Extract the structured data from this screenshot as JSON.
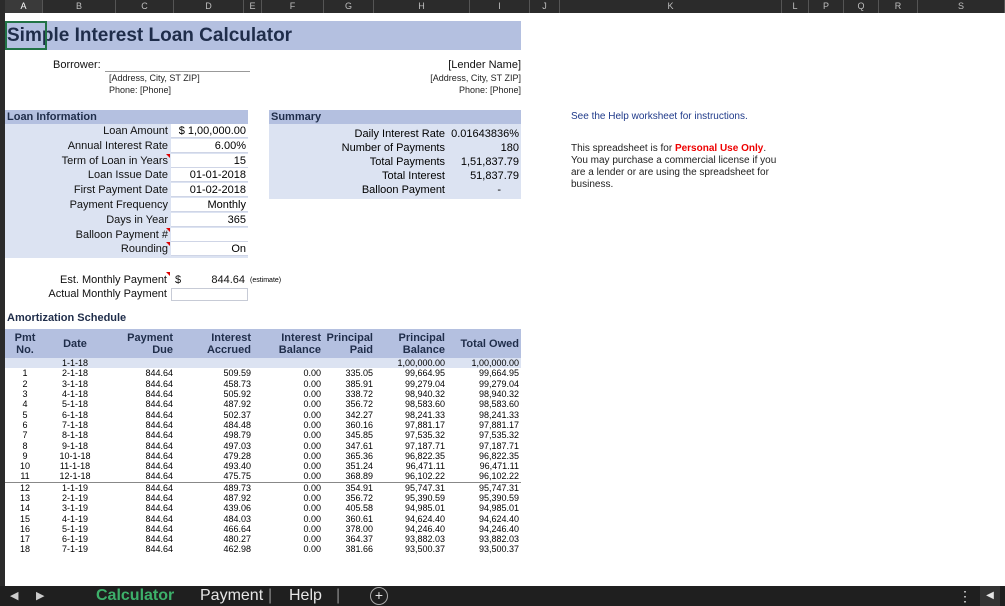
{
  "columns": [
    "A",
    "B",
    "C",
    "D",
    "E",
    "F",
    "G",
    "H",
    "I",
    "J",
    "K",
    "L",
    "P",
    "Q",
    "R",
    "S"
  ],
  "title": "Simple Interest Loan Calculator",
  "borrower": {
    "label": "Borrower:",
    "address": "[Address, City, ST ZIP]",
    "phone": "Phone: [Phone]"
  },
  "lender": {
    "name": "[Lender Name]",
    "address": "[Address, City, ST ZIP]",
    "phone": "Phone: [Phone]"
  },
  "loan_info": {
    "header": "Loan Information",
    "rows": [
      {
        "label": "Loan Amount",
        "value": "$ 1,00,000.00"
      },
      {
        "label": "Annual Interest Rate",
        "value": "6.00%"
      },
      {
        "label": "Term of Loan in Years",
        "value": "15"
      },
      {
        "label": "Loan Issue Date",
        "value": "01-01-2018"
      },
      {
        "label": "First Payment Date",
        "value": "01-02-2018"
      },
      {
        "label": "Payment Frequency",
        "value": "Monthly"
      },
      {
        "label": "Days in Year",
        "value": "365"
      },
      {
        "label": "Balloon Payment #",
        "value": ""
      },
      {
        "label": "Rounding",
        "value": "On"
      }
    ]
  },
  "summary": {
    "header": "Summary",
    "rows": [
      {
        "label": "Daily Interest Rate",
        "value": "0.01643836%"
      },
      {
        "label": "Number of Payments",
        "value": "180"
      },
      {
        "label": "Total Payments",
        "value": "1,51,837.79"
      },
      {
        "label": "Total Interest",
        "value": "51,837.79"
      },
      {
        "label": "Balloon Payment",
        "value": "-"
      }
    ]
  },
  "est_payment": {
    "label": "Est. Monthly Payment",
    "currency": "$",
    "value": "844.64",
    "note": "(estimate)"
  },
  "actual_payment": {
    "label": "Actual Monthly Payment",
    "value": ""
  },
  "help_text": "See the Help worksheet for instructions.",
  "license": {
    "pre": "This spreadsheet is for ",
    "bold": "Personal Use Only",
    "post": ". You may purchase a commercial license if you are a lender or are using the spreadsheet for business."
  },
  "amortization": {
    "title": "Amortization Schedule",
    "headers": [
      "Pmt No.",
      "Date",
      "Payment Due",
      "Interest Accrued",
      "Interest Balance",
      "Principal Paid",
      "Principal Balance",
      "Total Owed"
    ],
    "first_row": [
      "",
      "1-1-18",
      "",
      "",
      "",
      "",
      "1,00,000.00",
      "1,00,000.00"
    ],
    "rows": [
      [
        "1",
        "2-1-18",
        "844.64",
        "509.59",
        "0.00",
        "335.05",
        "99,664.95",
        "99,664.95"
      ],
      [
        "2",
        "3-1-18",
        "844.64",
        "458.73",
        "0.00",
        "385.91",
        "99,279.04",
        "99,279.04"
      ],
      [
        "3",
        "4-1-18",
        "844.64",
        "505.92",
        "0.00",
        "338.72",
        "98,940.32",
        "98,940.32"
      ],
      [
        "4",
        "5-1-18",
        "844.64",
        "487.92",
        "0.00",
        "356.72",
        "98,583.60",
        "98,583.60"
      ],
      [
        "5",
        "6-1-18",
        "844.64",
        "502.37",
        "0.00",
        "342.27",
        "98,241.33",
        "98,241.33"
      ],
      [
        "6",
        "7-1-18",
        "844.64",
        "484.48",
        "0.00",
        "360.16",
        "97,881.17",
        "97,881.17"
      ],
      [
        "7",
        "8-1-18",
        "844.64",
        "498.79",
        "0.00",
        "345.85",
        "97,535.32",
        "97,535.32"
      ],
      [
        "8",
        "9-1-18",
        "844.64",
        "497.03",
        "0.00",
        "347.61",
        "97,187.71",
        "97,187.71"
      ],
      [
        "9",
        "10-1-18",
        "844.64",
        "479.28",
        "0.00",
        "365.36",
        "96,822.35",
        "96,822.35"
      ],
      [
        "10",
        "11-1-18",
        "844.64",
        "493.40",
        "0.00",
        "351.24",
        "96,471.11",
        "96,471.11"
      ],
      [
        "11",
        "12-1-18",
        "844.64",
        "475.75",
        "0.00",
        "368.89",
        "96,102.22",
        "96,102.22"
      ],
      [
        "12",
        "1-1-19",
        "844.64",
        "489.73",
        "0.00",
        "354.91",
        "95,747.31",
        "95,747.31"
      ],
      [
        "13",
        "2-1-19",
        "844.64",
        "487.92",
        "0.00",
        "356.72",
        "95,390.59",
        "95,390.59"
      ],
      [
        "14",
        "3-1-19",
        "844.64",
        "439.06",
        "0.00",
        "405.58",
        "94,985.01",
        "94,985.01"
      ],
      [
        "15",
        "4-1-19",
        "844.64",
        "484.03",
        "0.00",
        "360.61",
        "94,624.40",
        "94,624.40"
      ],
      [
        "16",
        "5-1-19",
        "844.64",
        "466.64",
        "0.00",
        "378.00",
        "94,246.40",
        "94,246.40"
      ],
      [
        "17",
        "6-1-19",
        "844.64",
        "480.27",
        "0.00",
        "364.37",
        "93,882.03",
        "93,882.03"
      ],
      [
        "18",
        "7-1-19",
        "844.64",
        "462.98",
        "0.00",
        "381.66",
        "93,500.37",
        "93,500.37"
      ]
    ]
  },
  "tabs": [
    "Calculator",
    "Payment",
    "Help"
  ],
  "active_tab": "Calculator",
  "add_sheet": "+",
  "colors": {
    "header": "#b4c0e0",
    "panel": "#dce3f2",
    "active_tab": "#3db06a"
  }
}
